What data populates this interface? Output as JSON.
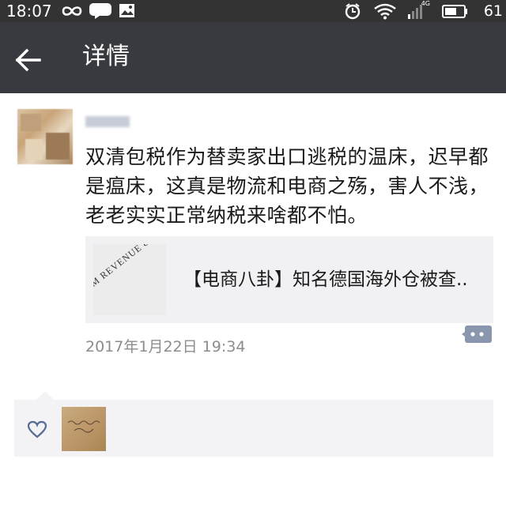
{
  "status_bar": {
    "time": "18:07",
    "battery_level": "61",
    "network_type": "4G",
    "icons": [
      "infinity-icon",
      "chat-bubble-icon",
      "image-notification-icon",
      "alarm-icon",
      "wifi-icon",
      "signal-icon",
      "battery-icon"
    ]
  },
  "header": {
    "title": "详情",
    "back_icon": "back-arrow-icon",
    "background": "#393a3f"
  },
  "post": {
    "text": "双清包税作为替卖家出口逃税的温床，迟早都是瘟床，这真是物流和电商之殇，害人不浅，老老实实正常纳税来啥都不怕。",
    "link": {
      "title": "【电商八卦】知名德国海外仓被查..",
      "thumbnail_text": "M REVENUE & CUSTOMS"
    },
    "timestamp": "2017年1月22日 19:34",
    "comment_icon": "comment-dots-icon"
  },
  "interactions": {
    "like_icon": "heart-outline-icon",
    "like_color": "#576b95"
  }
}
